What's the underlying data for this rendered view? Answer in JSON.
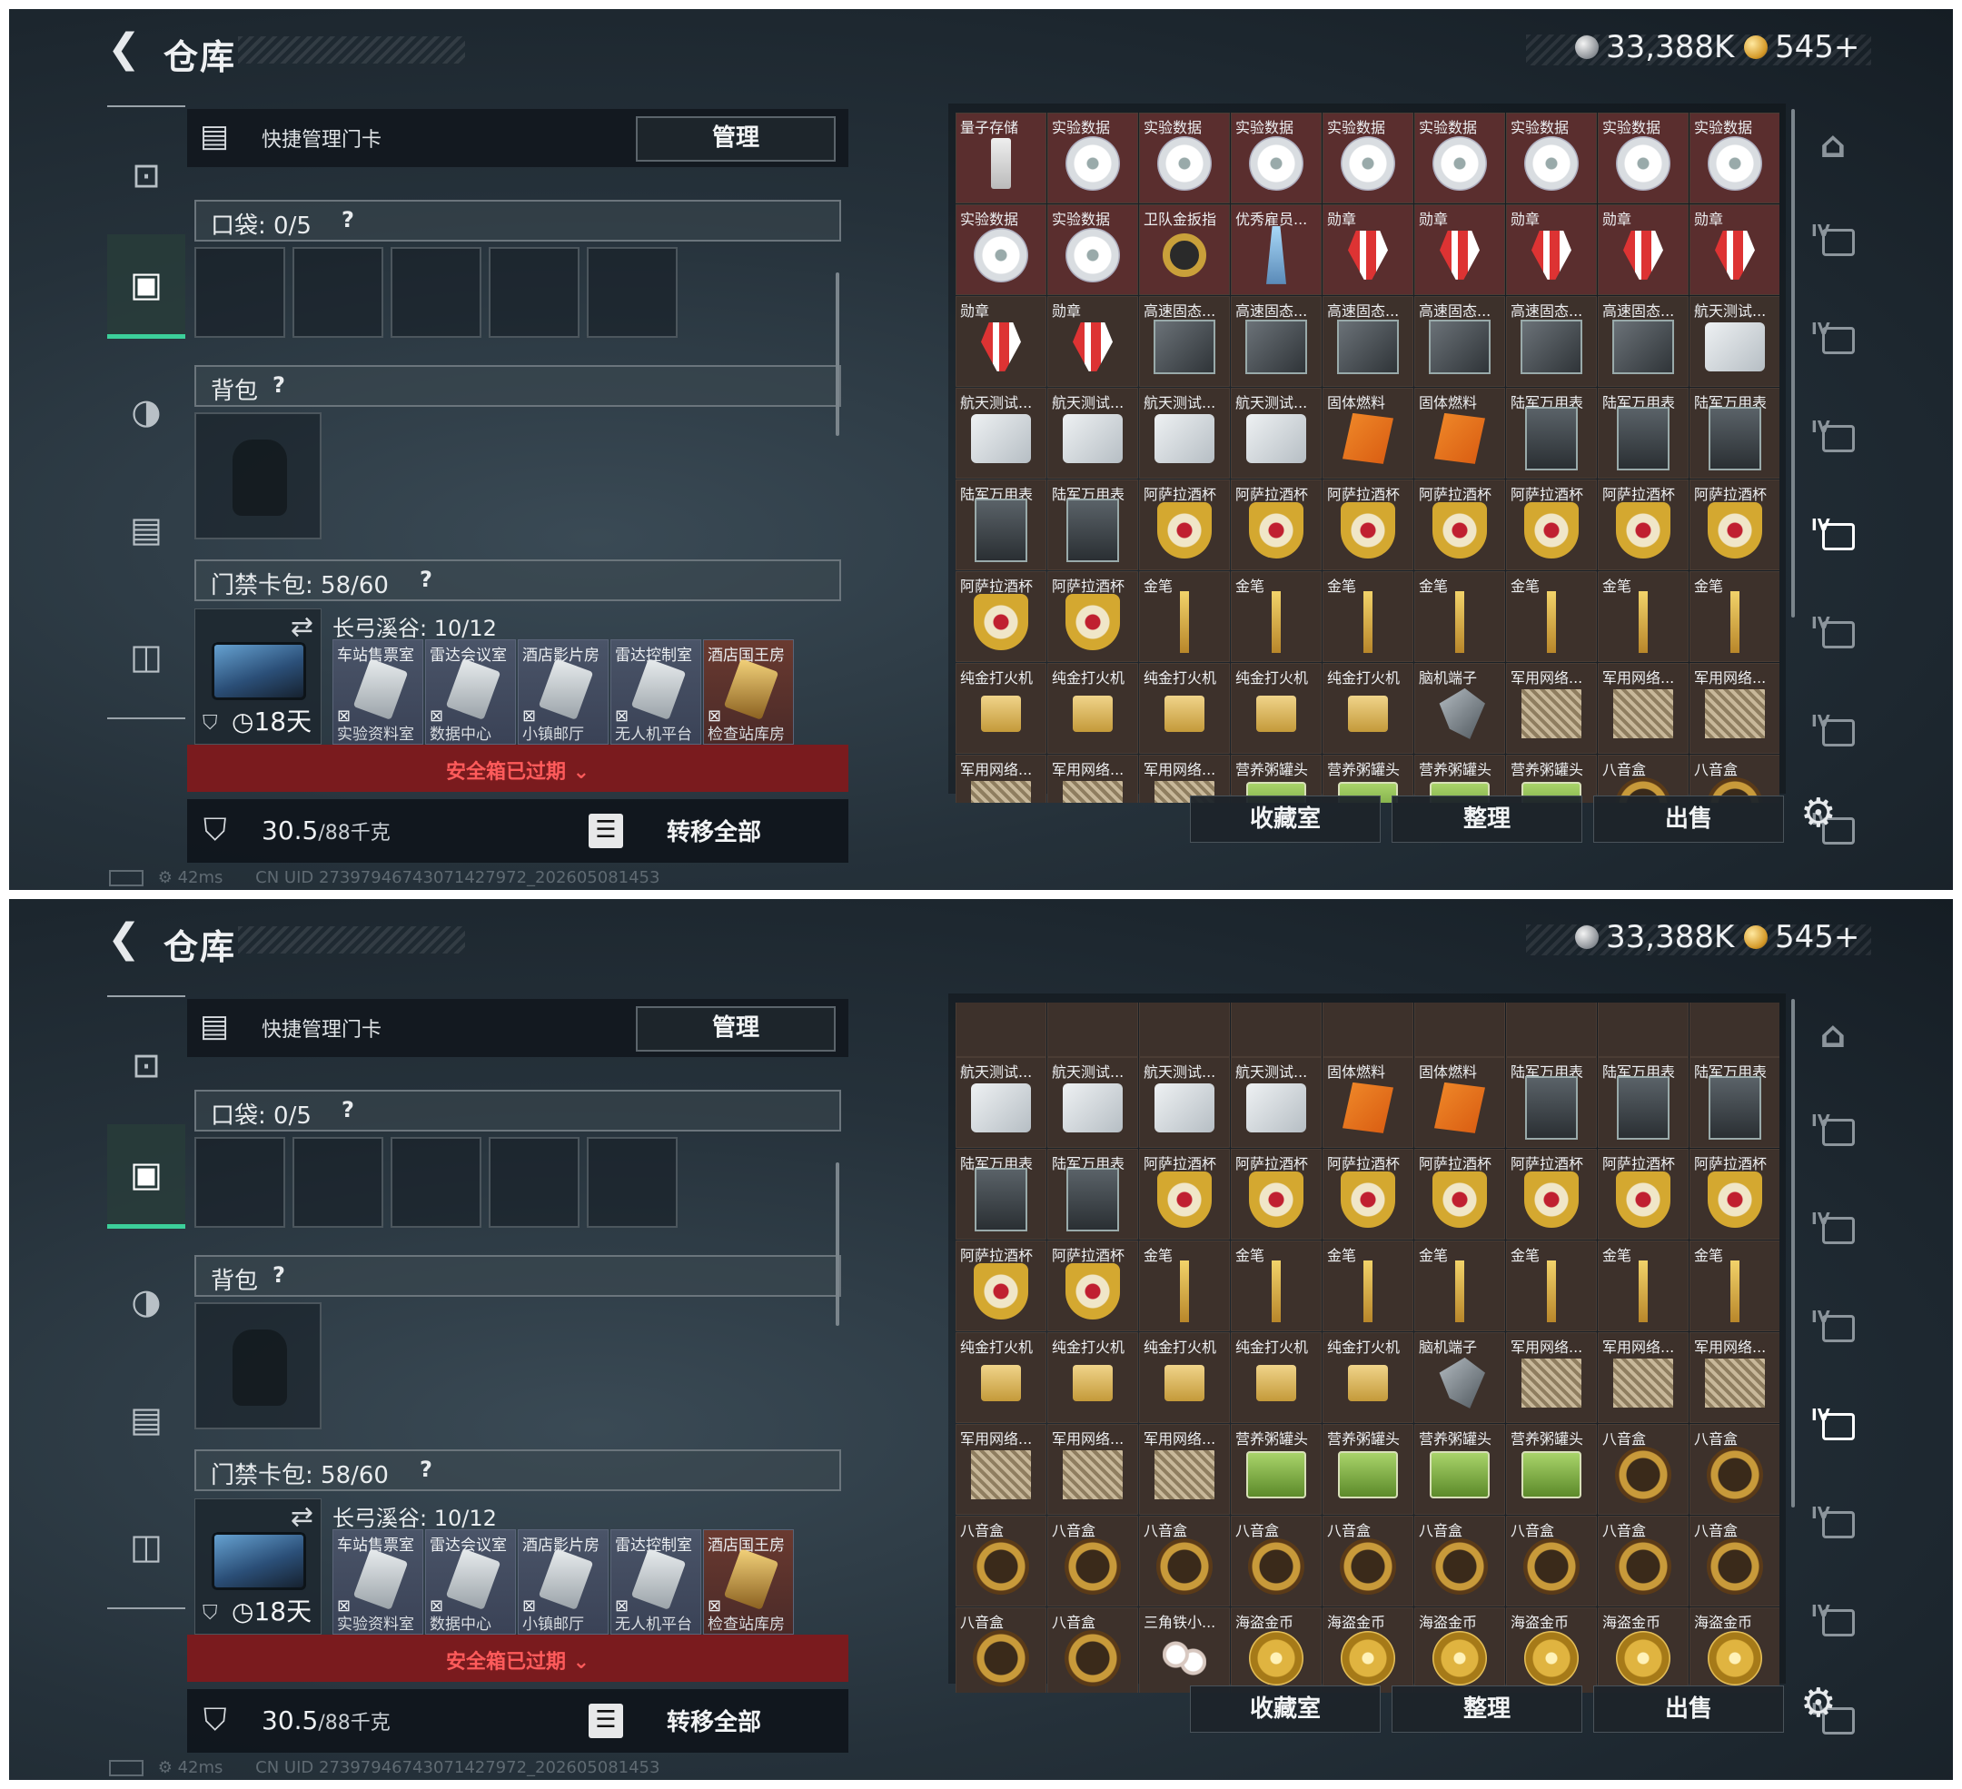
{
  "screens": [
    {
      "header": {
        "title": "仓库",
        "currency_silver": "33,388K",
        "currency_gold": "545+"
      },
      "quick_card": {
        "label": "快捷管理门卡",
        "manage_label": "管理"
      },
      "pocket": {
        "label": "口袋: 0/5",
        "help": "?"
      },
      "backpack": {
        "label": "背包",
        "help": "?"
      },
      "card_bag": {
        "label": "门禁卡包: 58/60",
        "help": "?",
        "zone": "长弓溪谷: 10/12",
        "days": "18天",
        "cards": [
          {
            "top": "车站售票室",
            "bottom": "实验资料室",
            "x": "⊠"
          },
          {
            "top": "雷达会议室",
            "bottom": "数据中心",
            "x": "⊠"
          },
          {
            "top": "酒店影片房",
            "bottom": "小镇邮厅",
            "x": "⊠"
          },
          {
            "top": "雷达控制室",
            "bottom": "无人机平台",
            "x": "⊠"
          },
          {
            "top": "酒店国王房",
            "bottom": "检查站库房",
            "x": "⊠"
          }
        ]
      },
      "expired_label": "安全箱已过期",
      "weight": {
        "value": "30.5",
        "limit": "/88千克"
      },
      "transfer_all_label": "转移全部",
      "buttons": {
        "collection": "收藏室",
        "sort": "整理",
        "sell": "出售"
      },
      "status": {
        "ping": "42ms",
        "uid": "CN UID 2739794674307142797​2_202605081453"
      },
      "grid_rows": [
        [
          "量子存储",
          "实验数据",
          "实验数据",
          "实验数据",
          "实验数据",
          "实验数据",
          "实验数据",
          "实验数据",
          "实验数据"
        ],
        [
          "实验数据",
          "实验数据",
          "卫队金扳指",
          "优秀雇员...",
          "勋章",
          "勋章",
          "勋章",
          "勋章",
          "勋章"
        ],
        [
          "勋章",
          "勋章",
          "高速固态...",
          "高速固态...",
          "高速固态...",
          "高速固态...",
          "高速固态...",
          "高速固态...",
          "航天测试..."
        ],
        [
          "航天测试...",
          "航天测试...",
          "航天测试...",
          "航天测试...",
          "固体燃料",
          "固体燃料",
          "陆军万用表",
          "陆军万用表",
          "陆军万用表"
        ],
        [
          "陆军万用表",
          "陆军万用表",
          "阿萨拉酒杯",
          "阿萨拉酒杯",
          "阿萨拉酒杯",
          "阿萨拉酒杯",
          "阿萨拉酒杯",
          "阿萨拉酒杯",
          "阿萨拉酒杯"
        ],
        [
          "阿萨拉酒杯",
          "阿萨拉酒杯",
          "金笔",
          "金笔",
          "金笔",
          "金笔",
          "金笔",
          "金笔",
          "金笔"
        ],
        [
          "纯金打火机",
          "纯金打火机",
          "纯金打火机",
          "纯金打火机",
          "纯金打火机",
          "脑机端子",
          "军用网络...",
          "军用网络...",
          "军用网络..."
        ],
        [
          "军用网络...",
          "军用网络...",
          "军用网络...",
          "营养粥罐头",
          "营养粥罐头",
          "营养粥罐头",
          "营养粥罐头",
          "八音盒",
          "八音盒"
        ]
      ],
      "grid_art": [
        [
          "usb",
          "disc",
          "disc",
          "disc",
          "disc",
          "disc",
          "disc",
          "disc",
          "disc"
        ],
        [
          "disc",
          "disc",
          "ring",
          "trophy",
          "medal",
          "medal",
          "medal",
          "medal",
          "medal"
        ],
        [
          "medal",
          "medal",
          "drive",
          "drive",
          "drive",
          "drive",
          "drive",
          "drive",
          "hdd"
        ],
        [
          "hdd",
          "hdd",
          "hdd",
          "hdd",
          "fuel",
          "fuel",
          "watch",
          "watch",
          "watch"
        ],
        [
          "watch",
          "watch",
          "cup",
          "cup",
          "cup",
          "cup",
          "cup",
          "cup",
          "cup"
        ],
        [
          "cup",
          "cup",
          "pen",
          "pen",
          "pen",
          "pen",
          "pen",
          "pen",
          "pen"
        ],
        [
          "lighter",
          "lighter",
          "lighter",
          "lighter",
          "lighter",
          "robot",
          "netbox",
          "netbox",
          "netbox"
        ],
        [
          "netbox",
          "netbox",
          "netbox",
          "can",
          "can",
          "can",
          "can",
          "mbox",
          "mbox"
        ]
      ],
      "red_rows": [
        0,
        1
      ]
    },
    {
      "header": {
        "title": "仓库",
        "currency_silver": "33,388K",
        "currency_gold": "545+"
      },
      "quick_card": {
        "label": "快捷管理门卡",
        "manage_label": "管理"
      },
      "pocket": {
        "label": "口袋: 0/5",
        "help": "?"
      },
      "backpack": {
        "label": "背包",
        "help": "?"
      },
      "card_bag": {
        "label": "门禁卡包: 58/60",
        "help": "?",
        "zone": "长弓溪谷: 10/12",
        "days": "18天",
        "cards": [
          {
            "top": "车站售票室",
            "bottom": "实验资料室",
            "x": "⊠"
          },
          {
            "top": "雷达会议室",
            "bottom": "数据中心",
            "x": "⊠"
          },
          {
            "top": "酒店影片房",
            "bottom": "小镇邮厅",
            "x": "⊠"
          },
          {
            "top": "雷达控制室",
            "bottom": "无人机平台",
            "x": "⊠"
          },
          {
            "top": "酒店国王房",
            "bottom": "检查站库房",
            "x": "⊠"
          }
        ]
      },
      "expired_label": "安全箱已过期",
      "weight": {
        "value": "30.5",
        "limit": "/88千克"
      },
      "transfer_all_label": "转移全部",
      "buttons": {
        "collection": "收藏室",
        "sort": "整理",
        "sell": "出售"
      },
      "status": {
        "ping": "42ms",
        "uid": "CN UID 2739794674307142797​2_202605081453"
      },
      "grid_rows": [
        [
          "航天测试...",
          "航天测试...",
          "航天测试...",
          "航天测试...",
          "固体燃料",
          "固体燃料",
          "陆军万用表",
          "陆军万用表",
          "陆军万用表"
        ],
        [
          "陆军万用表",
          "陆军万用表",
          "阿萨拉酒杯",
          "阿萨拉酒杯",
          "阿萨拉酒杯",
          "阿萨拉酒杯",
          "阿萨拉酒杯",
          "阿萨拉酒杯",
          "阿萨拉酒杯"
        ],
        [
          "阿萨拉酒杯",
          "阿萨拉酒杯",
          "金笔",
          "金笔",
          "金笔",
          "金笔",
          "金笔",
          "金笔",
          "金笔"
        ],
        [
          "纯金打火机",
          "纯金打火机",
          "纯金打火机",
          "纯金打火机",
          "纯金打火机",
          "脑机端子",
          "军用网络...",
          "军用网络...",
          "军用网络..."
        ],
        [
          "军用网络...",
          "军用网络...",
          "军用网络...",
          "营养粥罐头",
          "营养粥罐头",
          "营养粥罐头",
          "营养粥罐头",
          "八音盒",
          "八音盒"
        ],
        [
          "八音盒",
          "八音盒",
          "八音盒",
          "八音盒",
          "八音盒",
          "八音盒",
          "八音盒",
          "八音盒",
          "八音盒"
        ],
        [
          "八音盒",
          "八音盒",
          "三角铁小...",
          "海盗金币",
          "海盗金币",
          "海盗金币",
          "海盗金币",
          "海盗金币",
          "海盗金币"
        ]
      ],
      "grid_art": [
        [
          "hdd",
          "hdd",
          "hdd",
          "hdd",
          "fuel",
          "fuel",
          "watch",
          "watch",
          "watch"
        ],
        [
          "watch",
          "watch",
          "cup",
          "cup",
          "cup",
          "cup",
          "cup",
          "cup",
          "cup"
        ],
        [
          "cup",
          "cup",
          "pen",
          "pen",
          "pen",
          "pen",
          "pen",
          "pen",
          "pen"
        ],
        [
          "lighter",
          "lighter",
          "lighter",
          "lighter",
          "lighter",
          "robot",
          "netbox",
          "netbox",
          "netbox"
        ],
        [
          "netbox",
          "netbox",
          "netbox",
          "can",
          "can",
          "can",
          "can",
          "mbox",
          "mbox"
        ],
        [
          "mbox",
          "mbox",
          "mbox",
          "mbox",
          "mbox",
          "mbox",
          "mbox",
          "mbox",
          "mbox"
        ],
        [
          "mbox",
          "mbox",
          "pearl",
          "coinart",
          "coinart",
          "coinart",
          "coinart",
          "coinart",
          "coinart"
        ]
      ],
      "red_rows": []
    }
  ],
  "icons": {
    "back": "back-arrow-icon",
    "gun": "gun-icon",
    "armor": "armor-icon",
    "helmet": "helmet-icon",
    "bag": "bag-icon",
    "case": "case-icon",
    "gear": "gear-icon",
    "lock": "lock-icon",
    "list": "list-icon"
  },
  "right_nav": [
    "home-icon",
    "IV",
    "IV",
    "IV",
    "IV",
    "IV",
    "IV",
    "IV"
  ]
}
